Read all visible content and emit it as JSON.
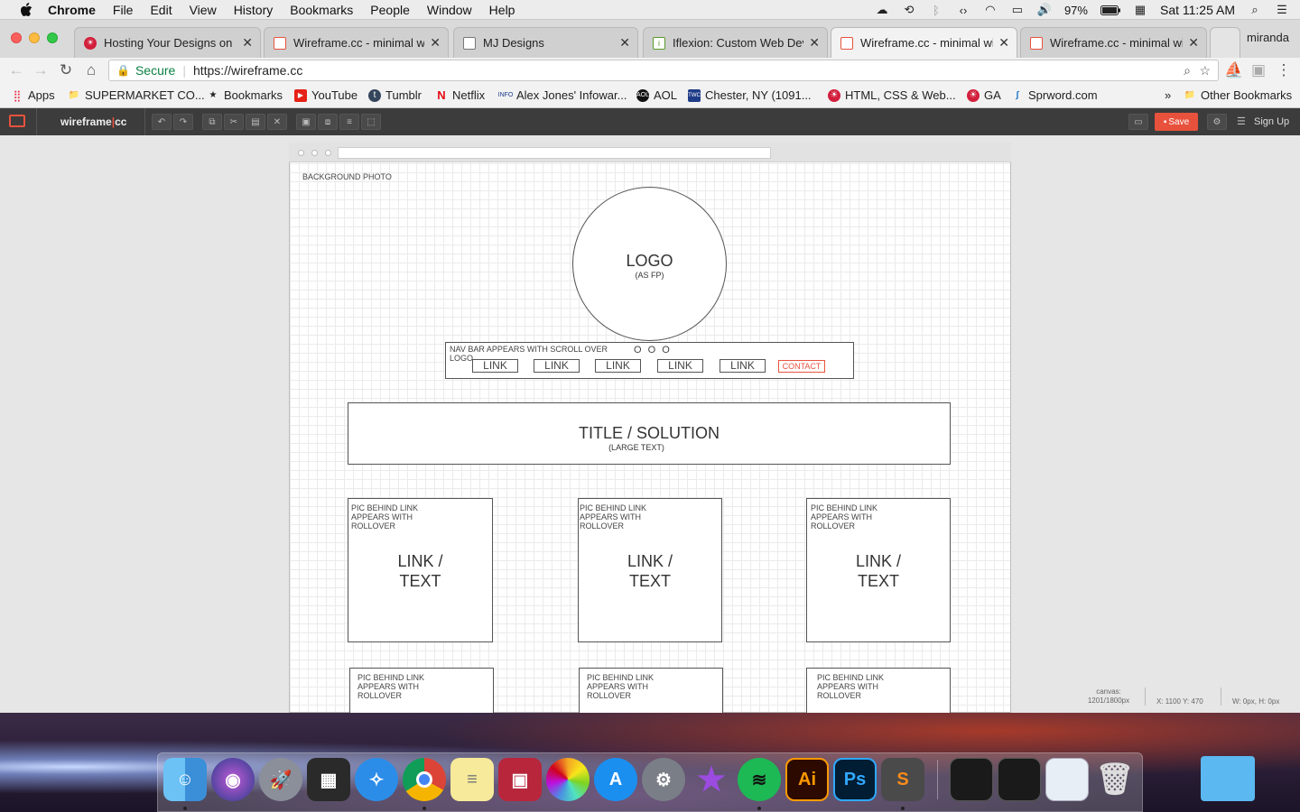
{
  "menubar": {
    "app": "Chrome",
    "items": [
      "File",
      "Edit",
      "View",
      "History",
      "Bookmarks",
      "People",
      "Window",
      "Help"
    ],
    "battery": "97%",
    "clock": "Sat 11:25 AM"
  },
  "tabs": [
    {
      "title": "Hosting Your Designs on | ",
      "icon": "hostgator-icon"
    },
    {
      "title": "Wireframe.cc - minimal wire",
      "icon": "wireframe-icon"
    },
    {
      "title": "MJ Designs",
      "icon": "page-icon"
    },
    {
      "title": "Iflexion: Custom Web Devel",
      "icon": "iflexion-icon"
    },
    {
      "title": "Wireframe.cc - minimal wire",
      "icon": "wireframe-icon",
      "active": true
    },
    {
      "title": "Wireframe.cc - minimal wire",
      "icon": "wireframe-icon"
    }
  ],
  "profile": "miranda",
  "omnibox": {
    "secure": "Secure",
    "url": "https://wireframe.cc"
  },
  "bookmarks": [
    "Apps",
    "SUPERMARKET CO...",
    "Bookmarks",
    "YouTube",
    "Tumblr",
    "Netflix",
    "Alex Jones' Infowar...",
    "AOL",
    "Chester, NY (1091...",
    "HTML, CSS & Web...",
    "GA",
    "Sprword.com"
  ],
  "other_bookmarks": "Other Bookmarks",
  "app": {
    "logo_a": "wireframe",
    "logo_b": "cc",
    "save": "Save",
    "signup": "Sign Up"
  },
  "status": {
    "canvas_label": "canvas:",
    "canvas_size": "1201/1800px",
    "coords": "X: 1100 Y: 470",
    "size": "W: 0px, H: 0px"
  },
  "wireframe": {
    "bg_label": "BACKGROUND PHOTO",
    "logo": "LOGO",
    "logo_sub": "(AS FP)",
    "nav_note": "NAV BAR APPEARS WITH SCROLL OVER LOGO",
    "nav_dots": "O O O",
    "nav_links": [
      "LINK",
      "LINK",
      "LINK",
      "LINK",
      "LINK"
    ],
    "contact": "CONTACT",
    "title": "TITLE / SOLUTION",
    "title_sub": "(LARGE TEXT)",
    "card_note": "PIC BEHIND LINK APPEARS WITH ROLLOVER",
    "card_title_a": "LINK /",
    "card_title_b": "TEXT"
  },
  "colors": {
    "accent": "#e8523d",
    "contact": "#e8523d",
    "toolbar": "#3c3c3c"
  }
}
